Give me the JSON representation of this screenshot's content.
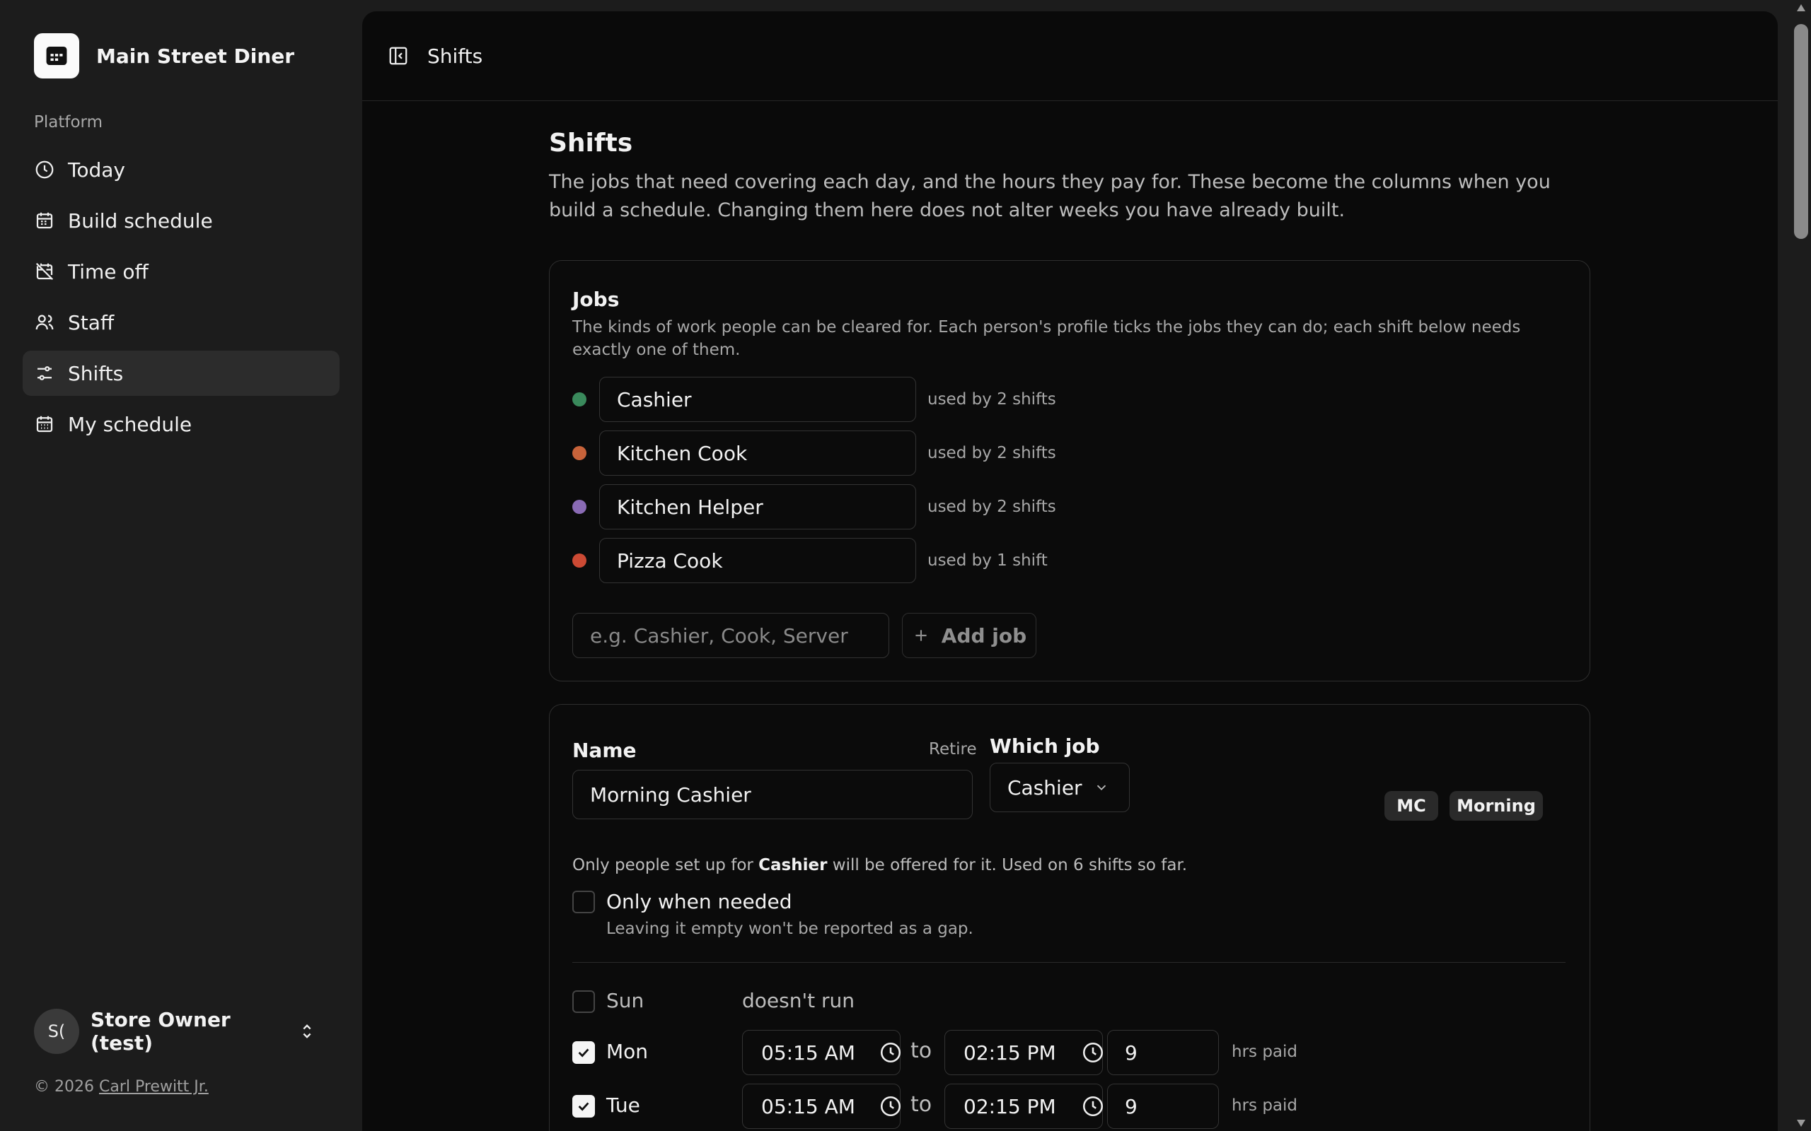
{
  "app": {
    "name": "Main Street Diner",
    "logo_icon": "table-icon"
  },
  "sidebar": {
    "group_label": "Platform",
    "items": [
      {
        "label": "Today",
        "icon": "clock-icon",
        "active": false
      },
      {
        "label": "Build schedule",
        "icon": "calendar-icon",
        "active": false
      },
      {
        "label": "Time off",
        "icon": "calendar-off-icon",
        "active": false
      },
      {
        "label": "Staff",
        "icon": "users-icon",
        "active": false
      },
      {
        "label": "Shifts",
        "icon": "sliders-icon",
        "active": true
      },
      {
        "label": "My schedule",
        "icon": "calendar-grid-icon",
        "active": false
      }
    ],
    "user": {
      "initials": "S(",
      "name": "Store Owner (test)"
    },
    "copyright_prefix": "© 2026 ",
    "copyright_link": "Carl Prewitt Jr."
  },
  "topbar": {
    "title": "Shifts"
  },
  "page": {
    "title": "Shifts",
    "description": "The jobs that need covering each day, and the hours they pay for. These become the columns when you build a schedule. Changing them here does not alter weeks you have already built."
  },
  "jobs": {
    "title": "Jobs",
    "description": "The kinds of work people can be cleared for. Each person's profile ticks the jobs they can do; each shift below needs exactly one of them.",
    "items": [
      {
        "name": "Cashier",
        "used": "used by 2 shifts",
        "color": "#3a8a5c"
      },
      {
        "name": "Kitchen Cook",
        "used": "used by 2 shifts",
        "color": "#c8633a"
      },
      {
        "name": "Kitchen Helper",
        "used": "used by 2 shifts",
        "color": "#8a6bb5"
      },
      {
        "name": "Pizza Cook",
        "used": "used by 1 shift",
        "color": "#cc4a34"
      }
    ],
    "new_placeholder": "e.g. Cashier, Cook, Server",
    "add_label": "Add job"
  },
  "shift": {
    "name_label": "Name",
    "retire_label": "Retire",
    "name_value": "Morning Cashier",
    "job_label": "Which job",
    "job_value": "Cashier",
    "badges": [
      "MC",
      "Morning"
    ],
    "hint_prefix": "Only people set up for ",
    "hint_job": "Cashier",
    "hint_suffix": " will be offered for it. Used on 6 shifts so far.",
    "only_when_needed_label": "Only when needed",
    "only_when_needed_checked": false,
    "only_when_needed_sub": "Leaving it empty won't be reported as a gap.",
    "days": [
      {
        "day": "Sun",
        "checked": false,
        "off_text": "doesn't run"
      },
      {
        "day": "Mon",
        "checked": true,
        "start": "05:15 AM",
        "end": "02:15 PM",
        "hours": "9",
        "to": "to",
        "hrs_label": "hrs paid"
      },
      {
        "day": "Tue",
        "checked": true,
        "start": "05:15 AM",
        "end": "02:15 PM",
        "hours": "9",
        "to": "to",
        "hrs_label": "hrs paid"
      }
    ]
  }
}
